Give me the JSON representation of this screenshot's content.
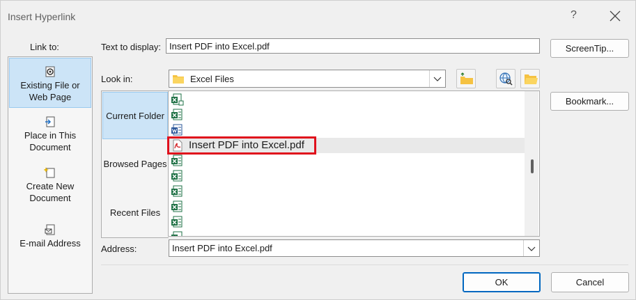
{
  "window": {
    "title": "Insert Hyperlink",
    "help_label": "?"
  },
  "link_to": {
    "label": "Link to:",
    "items": [
      {
        "line1": "Existing File or",
        "line2": "Web Page",
        "icon": "existing-file-icon"
      },
      {
        "line1": "Place in This",
        "line2": "Document",
        "icon": "place-in-document-icon"
      },
      {
        "line1": "Create New",
        "line2": "Document",
        "icon": "create-new-document-icon"
      },
      {
        "line1": "E-mail Address",
        "line2": "",
        "icon": "email-address-icon"
      }
    ]
  },
  "text_to_display": {
    "label": "Text to display:",
    "value": "Insert PDF into Excel.pdf"
  },
  "screentip_label": "ScreenTip...",
  "look_in": {
    "label": "Look in:",
    "value": "Excel Files"
  },
  "bookmark_label": "Bookmark...",
  "locations": [
    "Current Folder",
    "Browsed Pages",
    "Recent Files"
  ],
  "files": [
    {
      "type": "excel-shared",
      "name": ""
    },
    {
      "type": "excel",
      "name": ""
    },
    {
      "type": "word",
      "name": ""
    },
    {
      "type": "pdf",
      "name": "Insert PDF into Excel.pdf"
    },
    {
      "type": "excel",
      "name": ""
    },
    {
      "type": "excel",
      "name": ""
    },
    {
      "type": "excel",
      "name": ""
    },
    {
      "type": "excel",
      "name": ""
    },
    {
      "type": "excel",
      "name": ""
    },
    {
      "type": "excel",
      "name": ""
    }
  ],
  "address": {
    "label": "Address:",
    "value": "Insert PDF into Excel.pdf"
  },
  "ok_label": "OK",
  "cancel_label": "Cancel",
  "colors": {
    "accent": "#0067c0",
    "selection": "#cce4f7",
    "highlight_box": "#e0101c",
    "excel_green": "#1d7044",
    "word_blue": "#2b579a",
    "pdf_red": "#d4262a"
  }
}
